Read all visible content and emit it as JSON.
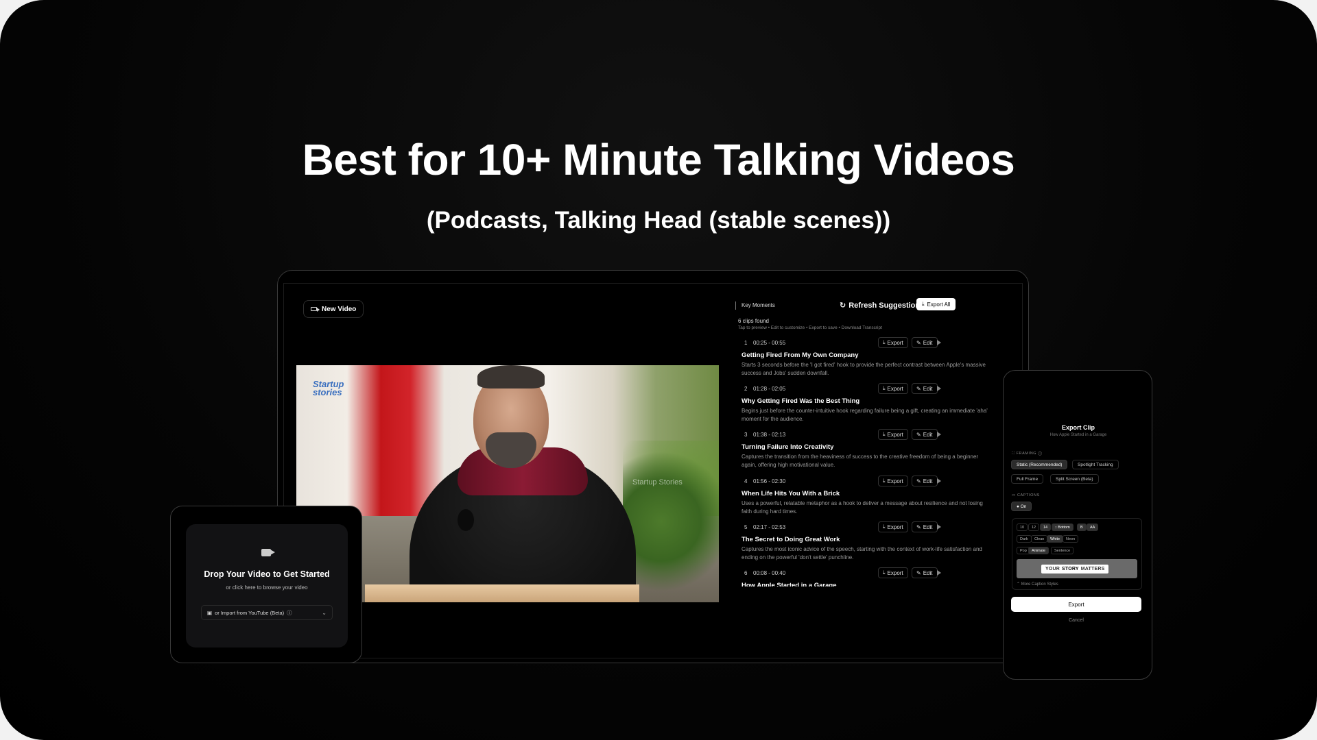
{
  "hero": {
    "headline": "Best for 10+ Minute Talking Videos",
    "subhead": "(Podcasts, Talking Head (stable scenes))"
  },
  "app": {
    "new_video_label": "New Video",
    "video": {
      "logo_line1": "Startup",
      "logo_line2": "stories",
      "watermark": "Startup Stories"
    },
    "panel": {
      "section_label": "Key Moments",
      "refresh_label": "Refresh Suggestions",
      "export_all_label": "Export All",
      "clips_count": "6 clips found",
      "tip_text": "Tap to preview • Edit to customize • Export to save •",
      "tip_link": "Download Transcript",
      "export_label": "Export",
      "edit_label": "Edit",
      "clips": [
        {
          "num": "1",
          "time": "00:25 - 00:55",
          "title": "Getting Fired From My Own Company",
          "desc": "Starts 3 seconds before the 'I got fired' hook to provide the perfect contrast between Apple's massive success and Jobs' sudden downfall."
        },
        {
          "num": "2",
          "time": "01:28 - 02:05",
          "title": "Why Getting Fired Was the Best Thing",
          "desc": "Begins just before the counter-intuitive hook regarding failure being a gift, creating an immediate 'aha' moment for the audience."
        },
        {
          "num": "3",
          "time": "01:38 - 02:13",
          "title": "Turning Failure Into Creativity",
          "desc": "Captures the transition from the heaviness of success to the creative freedom of being a beginner again, offering high motivational value."
        },
        {
          "num": "4",
          "time": "01:56 - 02:30",
          "title": "When Life Hits You With a Brick",
          "desc": "Uses a powerful, relatable metaphor as a hook to deliver a message about resilience and not losing faith during hard times."
        },
        {
          "num": "5",
          "time": "02:17 - 02:53",
          "title": "The Secret to Doing Great Work",
          "desc": "Captures the most iconic advice of the speech, starting with the context of work-life satisfaction and ending on the powerful 'don't settle' punchline."
        },
        {
          "num": "6",
          "time": "00:08 - 00:40",
          "title": "How Apple Started in a Garage",
          "desc": ""
        }
      ]
    }
  },
  "tablet": {
    "drop_title": "Drop Your Video to Get Started",
    "drop_sub": "or click here to browse your video",
    "youtube_label": "or Import from YouTube (Beta)"
  },
  "phone": {
    "title": "Export Clip",
    "subtitle": "How Apple Started in a Garage",
    "framing_label": "FRAMING",
    "framing_options": [
      "Static (Recommended)",
      "Spotlight Tracking",
      "Full Frame",
      "Split Screen (Beta)"
    ],
    "captions_label": "CAPTIONS",
    "captions_toggle": "On",
    "size_options": [
      "10",
      "12",
      "14",
      "↕ Bottom",
      "B",
      "AA"
    ],
    "theme_options": [
      "Dark",
      "Clean",
      "White",
      "Neon"
    ],
    "anim_options": [
      "Pop",
      "Animate",
      "Sentence"
    ],
    "preview_word1": "YOUR",
    "preview_word2": "STORY",
    "preview_word3": "MATTERS",
    "more_styles": "More Caption Styles",
    "export_label": "Export",
    "cancel_label": "Cancel"
  },
  "colors": {
    "background": "#000000",
    "accent": "#ffffff",
    "collar": "#8b1b34"
  }
}
